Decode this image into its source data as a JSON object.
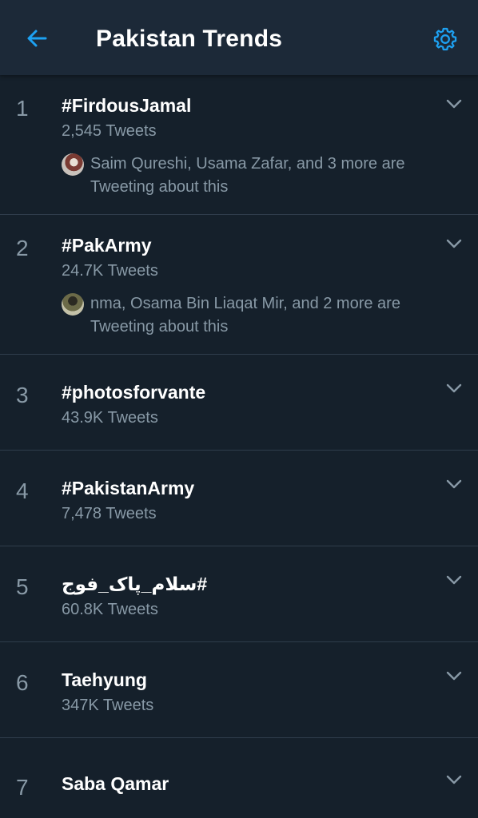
{
  "header": {
    "title": "Pakistan Trends",
    "back_icon": "back-arrow-icon",
    "settings_icon": "gear-icon",
    "accent_color": "#1da1f2"
  },
  "trends": [
    {
      "rank": "1",
      "name": "#FirdousJamal",
      "count": "2,545 Tweets",
      "context": "Saim Qureshi, Usama Zafar, and 3 more are Tweeting about this"
    },
    {
      "rank": "2",
      "name": "#PakArmy",
      "count": "24.7K Tweets",
      "context": "nma, Osama Bin Liaqat Mir, and 2 more are Tweeting about this"
    },
    {
      "rank": "3",
      "name": "#photosforvante",
      "count": "43.9K Tweets"
    },
    {
      "rank": "4",
      "name": "#PakistanArmy",
      "count": "7,478 Tweets"
    },
    {
      "rank": "5",
      "name": "#سلام_پاک_فوج",
      "count": "60.8K Tweets"
    },
    {
      "rank": "6",
      "name": "Taehyung",
      "count": "347K Tweets"
    },
    {
      "rank": "7",
      "name": "Saba Qamar"
    }
  ]
}
